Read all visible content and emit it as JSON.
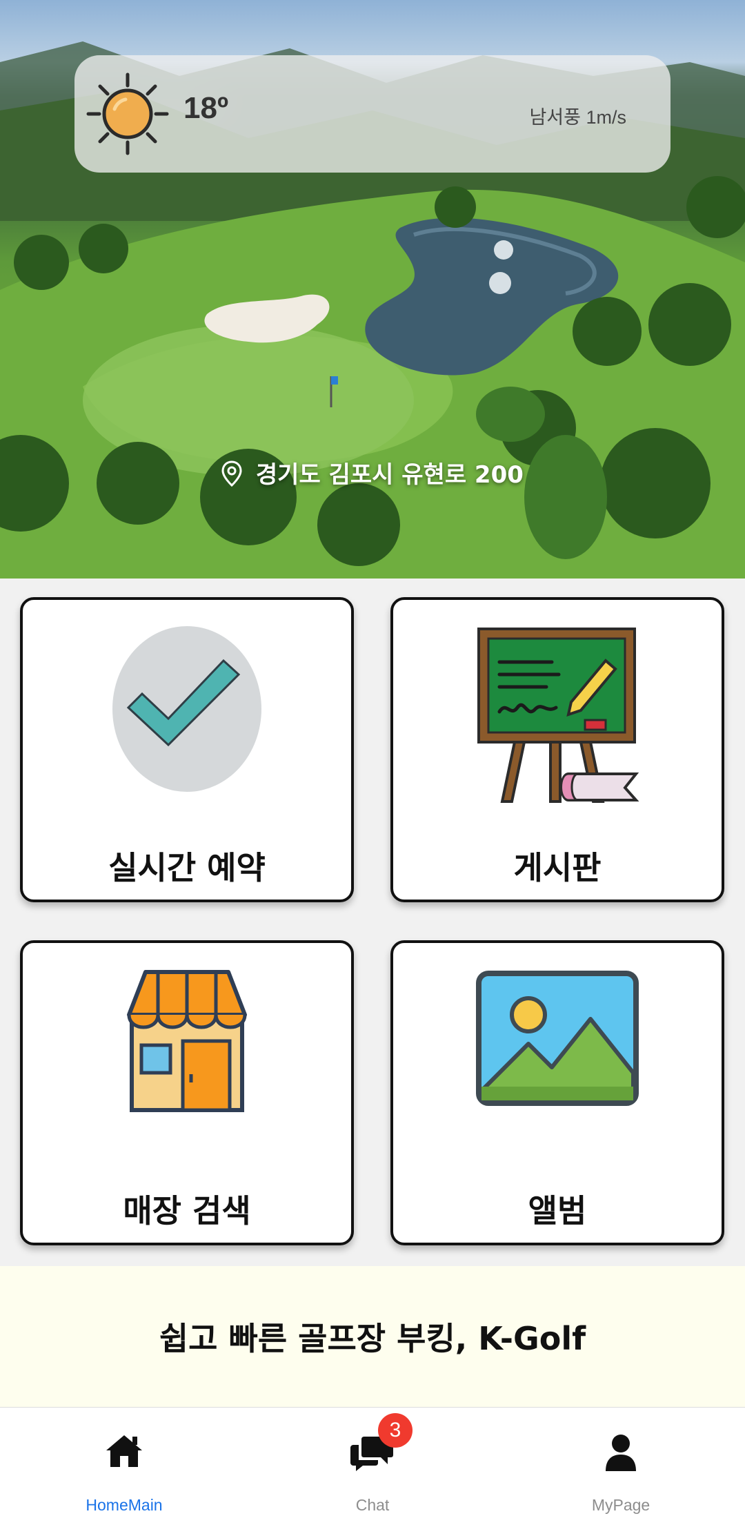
{
  "weather": {
    "icon": "sun-icon",
    "temperature": "18º",
    "wind": "남서풍 1m/s"
  },
  "location": {
    "icon": "map-pin-icon",
    "address": "경기도 김포시 유현로 200"
  },
  "menu": [
    {
      "label": "실시간 예약",
      "icon": "checkmark-icon"
    },
    {
      "label": "게시판",
      "icon": "chalkboard-icon"
    },
    {
      "label": "매장 검색",
      "icon": "store-icon"
    },
    {
      "label": "앨범",
      "icon": "picture-icon"
    }
  ],
  "banner": {
    "text": "쉽고 빠른 골프장 부킹, K-Golf"
  },
  "bottom_nav": {
    "items": [
      {
        "label": "HomeMain",
        "icon": "home-icon",
        "active": true
      },
      {
        "label": "Chat",
        "icon": "chat-icon",
        "badge": "3"
      },
      {
        "label": "MyPage",
        "icon": "user-icon"
      }
    ],
    "active_color": "#1a73e8"
  }
}
